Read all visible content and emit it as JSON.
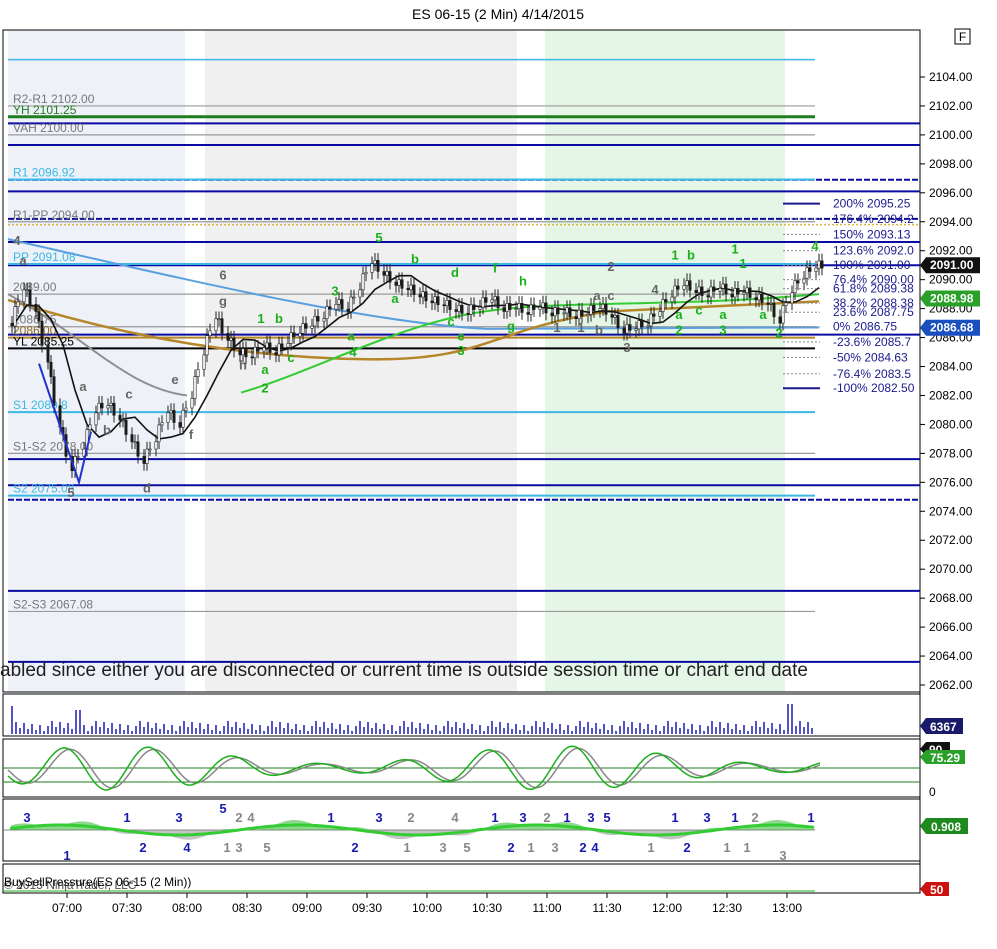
{
  "title": "ES 06-15 (2 Min)  4/14/2015",
  "f_button": "F",
  "colors": {
    "sess_grey": "#f0f0f0",
    "sess_green": "#e6f6e6",
    "blue_line": "#0a0aa0",
    "cyan": "#3bb8e6",
    "green_line": "#1e7d1e",
    "grey_line": "#9a9a9a",
    "brown": "#b5862a",
    "ma_green": "#33cc33",
    "ma_blue": "#5aa0e0",
    "ma_grey": "#909090",
    "candle_up": "#ffffff",
    "candle_dn": "#1a1a1a"
  },
  "message": "abled since either you are disconnected or current time is outside session time or chart end date",
  "copyright": "© 2015 NinjaTrader, LLC",
  "bsp_label": "BuySellPressure(ES 06-15 (2 Min))",
  "chart_data": {
    "type": "candlestick",
    "title": "ES 06-15 (2 Min)  4/14/2015",
    "x_ticks": [
      "07:00",
      "07:30",
      "08:00",
      "08:30",
      "09:00",
      "09:30",
      "10:00",
      "10:30",
      "11:00",
      "11:30",
      "12:00",
      "12:30",
      "13:00"
    ],
    "x_range": [
      "06:32",
      "13:20"
    ],
    "y_ticks": [
      "2104.00",
      "2102.00",
      "2100.00",
      "2098.00",
      "2096.00",
      "2094.00",
      "2092.00",
      "2090.00",
      "2088.00",
      "2086.00",
      "2084.00",
      "2082.00",
      "2080.00",
      "2078.00",
      "2076.00",
      "2074.00",
      "2072.00",
      "2070.00",
      "2068.00",
      "2066.00",
      "2064.00",
      "2062.00"
    ],
    "ylim": [
      2061.8,
      2105.5
    ],
    "close_path": [
      [
        "06:34",
        2087.0
      ],
      [
        "06:40",
        2089.5
      ],
      [
        "06:46",
        2088.0
      ],
      [
        "06:52",
        2084.5
      ],
      [
        "06:58",
        2080.0
      ],
      [
        "07:04",
        2077.0
      ],
      [
        "07:10",
        2078.5
      ],
      [
        "07:16",
        2081.0
      ],
      [
        "07:22",
        2081.5
      ],
      [
        "07:28",
        2080.5
      ],
      [
        "07:34",
        2079.0
      ],
      [
        "07:40",
        2077.5
      ],
      [
        "07:46",
        2079.0
      ],
      [
        "07:52",
        2081.0
      ],
      [
        "07:58",
        2080.0
      ],
      [
        "08:04",
        2082.0
      ],
      [
        "08:10",
        2085.0
      ],
      [
        "08:16",
        2087.5
      ],
      [
        "08:22",
        2086.0
      ],
      [
        "08:28",
        2085.0
      ],
      [
        "08:34",
        2084.8
      ],
      [
        "08:40",
        2085.5
      ],
      [
        "08:46",
        2085.0
      ],
      [
        "08:52",
        2085.8
      ],
      [
        "08:58",
        2086.5
      ],
      [
        "09:04",
        2087.0
      ],
      [
        "09:10",
        2087.5
      ],
      [
        "09:16",
        2088.5
      ],
      [
        "09:22",
        2088.0
      ],
      [
        "09:28",
        2089.5
      ],
      [
        "09:34",
        2091.3
      ],
      [
        "09:40",
        2090.5
      ],
      [
        "09:46",
        2089.8
      ],
      [
        "09:52",
        2089.5
      ],
      [
        "09:58",
        2089.0
      ],
      [
        "10:04",
        2088.6
      ],
      [
        "10:10",
        2088.4
      ],
      [
        "10:16",
        2088.0
      ],
      [
        "10:22",
        2087.8
      ],
      [
        "10:28",
        2088.3
      ],
      [
        "10:34",
        2088.8
      ],
      [
        "10:40",
        2088.0
      ],
      [
        "10:46",
        2088.2
      ],
      [
        "10:52",
        2087.8
      ],
      [
        "10:58",
        2088.3
      ],
      [
        "11:04",
        2087.7
      ],
      [
        "11:10",
        2087.9
      ],
      [
        "11:16",
        2087.5
      ],
      [
        "11:22",
        2087.8
      ],
      [
        "11:28",
        2088.2
      ],
      [
        "11:34",
        2087.6
      ],
      [
        "11:40",
        2086.5
      ],
      [
        "11:46",
        2086.8
      ],
      [
        "11:52",
        2087.0
      ],
      [
        "11:58",
        2088.0
      ],
      [
        "12:04",
        2089.0
      ],
      [
        "12:10",
        2089.8
      ],
      [
        "12:16",
        2089.3
      ],
      [
        "12:22",
        2089.0
      ],
      [
        "12:28",
        2089.6
      ],
      [
        "12:34",
        2089.0
      ],
      [
        "12:40",
        2089.3
      ],
      [
        "12:46",
        2088.8
      ],
      [
        "12:52",
        2088.5
      ],
      [
        "12:58",
        2087.2
      ],
      [
        "13:04",
        2089.3
      ],
      [
        "13:10",
        2090.3
      ],
      [
        "13:16",
        2091.0
      ]
    ],
    "levels": [
      {
        "label": "R2-R1 2102.00",
        "value": 2102.0,
        "kind": "grey"
      },
      {
        "label": "YH 2101.25",
        "value": 2101.25,
        "kind": "green"
      },
      {
        "label": "VAH 2100.00",
        "value": 2100.0,
        "kind": "grey"
      },
      {
        "label": "R1 2096.92",
        "value": 2096.92,
        "kind": "cyan"
      },
      {
        "label": "R1-PP 2094.00",
        "value": 2094.0,
        "kind": "grey"
      },
      {
        "label": "PP 2091.08",
        "value": 2091.08,
        "kind": "cyan"
      },
      {
        "label": "2089.00",
        "value": 2089.0,
        "kind": "grey"
      },
      {
        "label": "2086.75",
        "value": 2086.75,
        "kind": "grey"
      },
      {
        "label": "2086.00",
        "value": 2086.0,
        "kind": "brown"
      },
      {
        "label": "YL 2085.25",
        "value": 2085.25,
        "kind": "black"
      },
      {
        "label": "S1 2080.8",
        "value": 2080.85,
        "kind": "cyan"
      },
      {
        "label": "S1-S2 2078.00",
        "value": 2078.0,
        "kind": "grey"
      },
      {
        "label": "S2 2075.08",
        "value": 2075.08,
        "kind": "cyan"
      },
      {
        "label": "S2-S3 2067.08",
        "value": 2067.08,
        "kind": "grey"
      }
    ],
    "fib_levels": [
      {
        "label": "200%  2095.25",
        "value": 2095.25
      },
      {
        "label": "176.4%  2094.2",
        "value": 2094.2
      },
      {
        "label": "150%  2093.13",
        "value": 2093.13
      },
      {
        "label": "123.6%  2092.0",
        "value": 2092.0
      },
      {
        "label": "100%  2091.00",
        "value": 2091.0
      },
      {
        "label": "76.4%  2090.00",
        "value": 2090.0
      },
      {
        "label": "61.8%  2089.38",
        "value": 2089.38
      },
      {
        "label": "38.2%  2088.38",
        "value": 2088.38
      },
      {
        "label": "23.6%  2087.75",
        "value": 2087.75
      },
      {
        "label": "0%  2086.75",
        "value": 2086.75
      },
      {
        "label": "-23.6%  2085.7",
        "value": 2085.7
      },
      {
        "label": "-50%  2084.63",
        "value": 2084.63
      },
      {
        "label": "-76.4%  2083.5",
        "value": 2083.5
      },
      {
        "label": "-100%  2082.50",
        "value": 2082.5
      }
    ],
    "price_tags": [
      {
        "label": "2091.00",
        "value": 2091.0,
        "bg": "#111111",
        "fg": "#ffffff"
      },
      {
        "label": "2088.98",
        "value": 2088.7,
        "bg": "#2aa02a",
        "fg": "#ffffff"
      },
      {
        "label": "2086.68",
        "value": 2086.68,
        "bg": "#1a4fc0",
        "fg": "#ffffff"
      }
    ],
    "waves": [
      {
        "t": "4",
        "time": "06:35",
        "price": 2092.4,
        "color": "#666"
      },
      {
        "t": "a",
        "time": "06:38",
        "price": 2091.0,
        "color": "#666"
      },
      {
        "t": "5",
        "time": "07:02",
        "price": 2075.0,
        "color": "#666"
      },
      {
        "t": "a",
        "time": "07:08",
        "price": 2082.3,
        "color": "#666"
      },
      {
        "t": "b",
        "time": "07:20",
        "price": 2079.3,
        "color": "#666"
      },
      {
        "t": "c",
        "time": "07:31",
        "price": 2081.8,
        "color": "#666"
      },
      {
        "t": "d",
        "time": "07:40",
        "price": 2075.3,
        "color": "#666"
      },
      {
        "t": "e",
        "time": "07:54",
        "price": 2082.8,
        "color": "#666"
      },
      {
        "t": "f",
        "time": "08:02",
        "price": 2079.0,
        "color": "#666"
      },
      {
        "t": "6",
        "time": "08:18",
        "price": 2090.0,
        "color": "#666"
      },
      {
        "t": "g",
        "time": "08:18",
        "price": 2088.2,
        "color": "#666"
      },
      {
        "t": "h",
        "time": "08:28",
        "price": 2083.8,
        "color": "#666"
      },
      {
        "t": "1",
        "time": "08:37",
        "price": 2087.0,
        "color": "#1bb01b"
      },
      {
        "t": "b",
        "time": "08:46",
        "price": 2087.0,
        "color": "#1bb01b"
      },
      {
        "t": "a",
        "time": "08:39",
        "price": 2083.5,
        "color": "#1bb01b"
      },
      {
        "t": "2",
        "time": "08:39",
        "price": 2082.2,
        "color": "#1bb01b"
      },
      {
        "t": "c",
        "time": "08:52",
        "price": 2084.3,
        "color": "#1bb01b"
      },
      {
        "t": "3",
        "time": "09:14",
        "price": 2088.9,
        "color": "#1bb01b"
      },
      {
        "t": "a",
        "time": "09:22",
        "price": 2085.8,
        "color": "#1bb01b"
      },
      {
        "t": "4",
        "time": "09:23",
        "price": 2084.7,
        "color": "#1bb01b"
      },
      {
        "t": "5",
        "time": "09:36",
        "price": 2092.6,
        "color": "#1bb01b"
      },
      {
        "t": "a",
        "time": "09:44",
        "price": 2088.4,
        "color": "#1bb01b"
      },
      {
        "t": "b",
        "time": "09:54",
        "price": 2091.1,
        "color": "#1bb01b"
      },
      {
        "t": "d",
        "time": "10:14",
        "price": 2090.2,
        "color": "#1bb01b"
      },
      {
        "t": "c",
        "time": "10:12",
        "price": 2086.8,
        "color": "#1bb01b"
      },
      {
        "t": "e",
        "time": "10:17",
        "price": 2085.8,
        "color": "#1bb01b"
      },
      {
        "t": "3",
        "time": "10:17",
        "price": 2084.8,
        "color": "#1bb01b"
      },
      {
        "t": "f",
        "time": "10:34",
        "price": 2090.5,
        "color": "#1bb01b"
      },
      {
        "t": "h",
        "time": "10:48",
        "price": 2089.6,
        "color": "#1bb01b"
      },
      {
        "t": "g",
        "time": "10:42",
        "price": 2086.5,
        "color": "#1bb01b"
      },
      {
        "t": "2",
        "time": "11:32",
        "price": 2090.6,
        "color": "#666"
      },
      {
        "t": "a",
        "time": "11:25",
        "price": 2088.6,
        "color": "#666"
      },
      {
        "t": "c",
        "time": "11:32",
        "price": 2088.6,
        "color": "#666"
      },
      {
        "t": "1",
        "time": "11:05",
        "price": 2086.4,
        "color": "#666"
      },
      {
        "t": "1",
        "time": "11:17",
        "price": 2086.4,
        "color": "#666"
      },
      {
        "t": "b",
        "time": "11:26",
        "price": 2086.2,
        "color": "#666"
      },
      {
        "t": "3",
        "time": "11:40",
        "price": 2085.0,
        "color": "#666"
      },
      {
        "t": "4",
        "time": "11:54",
        "price": 2089.0,
        "color": "#666"
      },
      {
        "t": "1",
        "time": "12:04",
        "price": 2091.4,
        "color": "#1bb01b"
      },
      {
        "t": "b",
        "time": "12:12",
        "price": 2091.4,
        "color": "#1bb01b"
      },
      {
        "t": "1",
        "time": "12:34",
        "price": 2091.8,
        "color": "#1bb01b"
      },
      {
        "t": "1",
        "time": "12:38",
        "price": 2090.8,
        "color": "#1bb01b"
      },
      {
        "t": "a",
        "time": "12:06",
        "price": 2087.3,
        "color": "#1bb01b"
      },
      {
        "t": "2",
        "time": "12:06",
        "price": 2086.2,
        "color": "#1bb01b"
      },
      {
        "t": "c",
        "time": "12:16",
        "price": 2087.6,
        "color": "#1bb01b"
      },
      {
        "t": "a",
        "time": "12:28",
        "price": 2087.3,
        "color": "#1bb01b"
      },
      {
        "t": "3",
        "time": "12:28",
        "price": 2086.2,
        "color": "#1bb01b"
      },
      {
        "t": "a",
        "time": "12:48",
        "price": 2087.3,
        "color": "#1bb01b"
      },
      {
        "t": "2",
        "time": "12:56",
        "price": 2086.0,
        "color": "#1bb01b"
      },
      {
        "t": "4",
        "time": "13:14",
        "price": 2092.0,
        "color": "#1bb01b"
      }
    ],
    "volume_value": "6367",
    "stoch_value": "90",
    "stoch_value2": "75.29",
    "stoch_zero": "0",
    "macd_value": "0.908",
    "bsp_value": "50",
    "macd_waves": [
      {
        "t": "3",
        "time": "06:40",
        "row": 0,
        "color": "#1a1ab0"
      },
      {
        "t": "1",
        "time": "07:00",
        "row": 2,
        "color": "#1a1ab0"
      },
      {
        "t": "1",
        "time": "07:30",
        "row": 0,
        "color": "#1a1ab0"
      },
      {
        "t": "2",
        "time": "07:38",
        "row": 1,
        "color": "#1a1ab0"
      },
      {
        "t": "3",
        "time": "07:56",
        "row": 0,
        "color": "#1a1ab0"
      },
      {
        "t": "4",
        "time": "08:00",
        "row": 1,
        "color": "#1a1ab0"
      },
      {
        "t": "5",
        "time": "08:18",
        "row": -1,
        "color": "#1a1ab0"
      },
      {
        "t": "2",
        "time": "08:26",
        "row": 0,
        "color": "#888"
      },
      {
        "t": "4",
        "time": "08:32",
        "row": 0,
        "color": "#888"
      },
      {
        "t": "1",
        "time": "08:20",
        "row": 1,
        "color": "#888"
      },
      {
        "t": "3",
        "time": "08:26",
        "row": 1,
        "color": "#888"
      },
      {
        "t": "5",
        "time": "08:40",
        "row": 1,
        "color": "#888"
      },
      {
        "t": "1",
        "time": "09:12",
        "row": 0,
        "color": "#1a1ab0"
      },
      {
        "t": "2",
        "time": "09:24",
        "row": 1,
        "color": "#1a1ab0"
      },
      {
        "t": "3",
        "time": "09:36",
        "row": 0,
        "color": "#1a1ab0"
      },
      {
        "t": "2",
        "time": "09:52",
        "row": 0,
        "color": "#888"
      },
      {
        "t": "1",
        "time": "09:50",
        "row": 1,
        "color": "#888"
      },
      {
        "t": "4",
        "time": "10:14",
        "row": 0,
        "color": "#888"
      },
      {
        "t": "3",
        "time": "10:08",
        "row": 1,
        "color": "#888"
      },
      {
        "t": "5",
        "time": "10:20",
        "row": 1,
        "color": "#888"
      },
      {
        "t": "1",
        "time": "10:34",
        "row": 0,
        "color": "#1a1ab0"
      },
      {
        "t": "2",
        "time": "10:42",
        "row": 1,
        "color": "#1a1ab0"
      },
      {
        "t": "3",
        "time": "10:48",
        "row": 0,
        "color": "#1a1ab0"
      },
      {
        "t": "1",
        "time": "10:52",
        "row": 1,
        "color": "#888"
      },
      {
        "t": "2",
        "time": "11:00",
        "row": 0,
        "color": "#888"
      },
      {
        "t": "3",
        "time": "11:04",
        "row": 1,
        "color": "#888"
      },
      {
        "t": "1",
        "time": "11:10",
        "row": 0,
        "color": "#1a1ab0"
      },
      {
        "t": "2",
        "time": "11:18",
        "row": 1,
        "color": "#1a1ab0"
      },
      {
        "t": "3",
        "time": "11:22",
        "row": 0,
        "color": "#1a1ab0"
      },
      {
        "t": "4",
        "time": "11:24",
        "row": 1,
        "color": "#1a1ab0"
      },
      {
        "t": "5",
        "time": "11:30",
        "row": 0,
        "color": "#1a1ab0"
      },
      {
        "t": "1",
        "time": "11:52",
        "row": 1,
        "color": "#888"
      },
      {
        "t": "1",
        "time": "12:04",
        "row": 0,
        "color": "#1a1ab0"
      },
      {
        "t": "2",
        "time": "12:10",
        "row": 1,
        "color": "#1a1ab0"
      },
      {
        "t": "3",
        "time": "12:20",
        "row": 0,
        "color": "#1a1ab0"
      },
      {
        "t": "1",
        "time": "12:34",
        "row": 0,
        "color": "#1a1ab0"
      },
      {
        "t": "2",
        "time": "12:44",
        "row": 0,
        "color": "#888"
      },
      {
        "t": "1",
        "time": "12:30",
        "row": 1,
        "color": "#888"
      },
      {
        "t": "1",
        "time": "12:40",
        "row": 1,
        "color": "#888"
      },
      {
        "t": "3",
        "time": "12:58",
        "row": 2,
        "color": "#888"
      },
      {
        "t": "1",
        "time": "13:12",
        "row": 0,
        "color": "#1a1ab0"
      }
    ]
  }
}
